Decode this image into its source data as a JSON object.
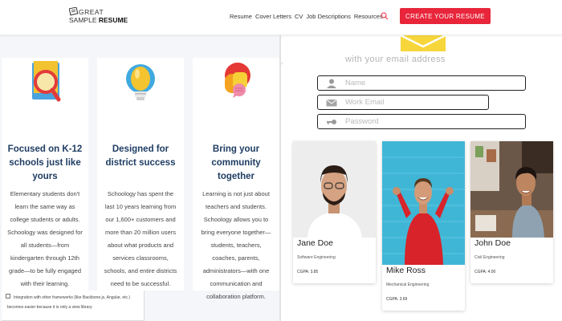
{
  "header": {
    "logo_line1": "GREAT",
    "logo_line2_prefix": "SAMPLE ",
    "logo_line2_bold": "RESUME",
    "nav": [
      "Resume",
      "Cover Letters",
      "CV",
      "Job Descriptions",
      "Resources"
    ],
    "cta_label": "CREATE YOUR RESUME",
    "accent": "#e8253a"
  },
  "features": [
    {
      "icon": "magnifier-book-icon",
      "title": "Focused on K-12 schools just like yours",
      "body": "Elementary students don't learn the same way as college students or adults. Schoology was designed for all students—from kindergarten through 12th grade—to be fully engaged with their learning."
    },
    {
      "icon": "lightbulb-icon",
      "title": "Designed for district success",
      "body": "Schoology has spent the last 10 years learning from our 1,600+ customers and more than 20 million users about what products and services classrooms, schools, and entire districts need to be successful."
    },
    {
      "icon": "speech-bubbles-icon",
      "title": "Bring your community together",
      "body": "Learning is not just about teachers and students. Schoology allows you to bring everyone together—students, teachers, coaches, parents, administrators—with one communication and collaboration platform."
    }
  ],
  "footnote": "Integration with other frameworks (like Backbone.js, Angular, etc.) becomes easier because it is only a view library",
  "form": {
    "heading": "with your email address",
    "name_placeholder": "Name",
    "email_placeholder": "Work Email",
    "password_placeholder": "Password"
  },
  "profiles": [
    {
      "name": "Jane Doe",
      "major": "Software Engineering",
      "gpa": "CGPA: 3.85"
    },
    {
      "name": "Mike Ross",
      "major": "Mechanical Engineering",
      "gpa": "CGPA: 3.69"
    },
    {
      "name": "John Doe",
      "major": "Civil Engineering",
      "gpa": "CGPA: 4.00"
    }
  ]
}
